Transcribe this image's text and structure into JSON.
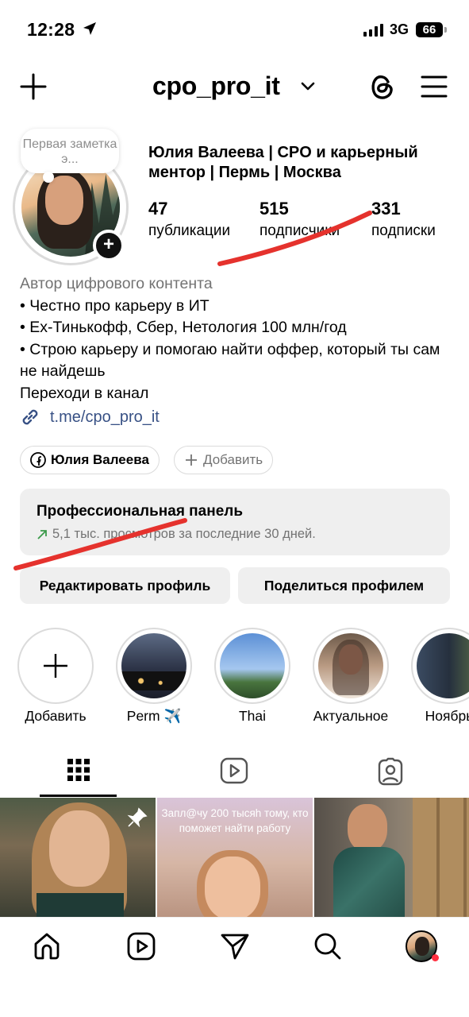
{
  "status_bar": {
    "time": "12:28",
    "network": "3G",
    "battery": "66"
  },
  "header": {
    "username": "cpo_pro_it"
  },
  "note": {
    "text": "Первая заметка э..."
  },
  "profile": {
    "full_name": "Юлия Валеева | CPO и карьерный ментор | Пермь | Москва",
    "stats": [
      {
        "value": "47",
        "label": "публикации"
      },
      {
        "value": "515",
        "label": "подписчики"
      },
      {
        "value": "331",
        "label": "подписки"
      }
    ],
    "category": "Автор цифрового контента",
    "bio_lines": [
      "• Честно про карьеру в ИТ",
      "• Ex-Тинькофф, Сбер, Нетология 100 млн/год",
      "• Строю карьеру и помогаю найти оффер, который ты сам не найдешь",
      "Переходи в канал"
    ],
    "link": "t.me/cpo_pro_it"
  },
  "pills": {
    "facebook_name": "Юлия Валеева",
    "add_label": "Добавить"
  },
  "pro_panel": {
    "title": "Профессиональная панель",
    "subtitle": "5,1 тыс. просмотров за последние 30 дней."
  },
  "buttons": {
    "edit": "Редактировать профиль",
    "share": "Поделиться профилем"
  },
  "highlights": [
    {
      "label": "Добавить"
    },
    {
      "label": "Perm ✈️"
    },
    {
      "label": "Thai"
    },
    {
      "label": "Актуальное"
    },
    {
      "label": "Ноябрь"
    }
  ],
  "grid": {
    "post2_caption": "Запл@чу 200 тысяh тому, кто поможет найти работу"
  },
  "colors": {
    "link": "#385185",
    "annotation": "#e5322d",
    "notification": "#ff3040"
  }
}
